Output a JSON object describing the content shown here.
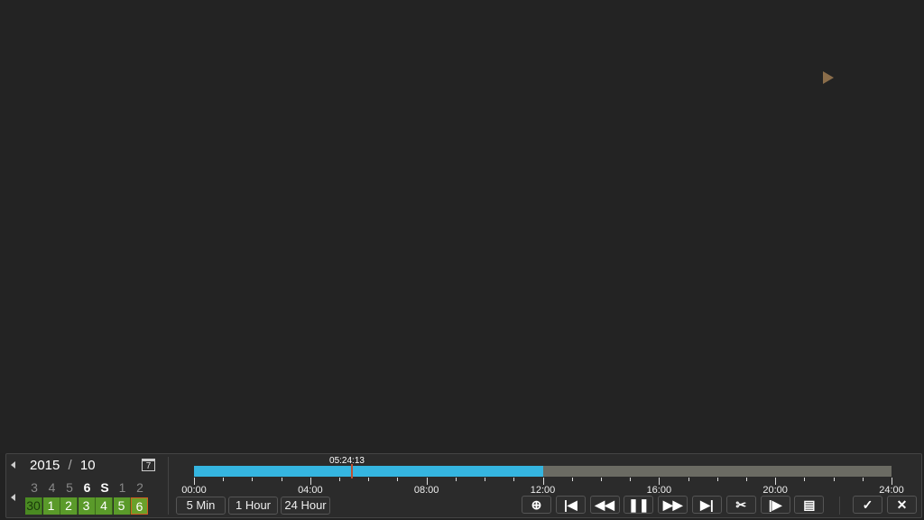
{
  "video": {
    "play_indicator_icon": "play-icon",
    "indicator_color": "#8a6d4a"
  },
  "calendar": {
    "year": "2015",
    "separator": "/",
    "month": "10",
    "calendar_icon_label": "7",
    "weekdays": [
      "3",
      "4",
      "5",
      "6",
      "S",
      "1",
      "2"
    ],
    "days": [
      "30",
      "1",
      "2",
      "3",
      "4",
      "5",
      "6"
    ],
    "selected_day": "6",
    "record_color": "#5a9a2a"
  },
  "timeline": {
    "current_time": "05:24:13",
    "current_hours": 5.4036,
    "recorded_ranges": [
      [
        0,
        12
      ]
    ],
    "record_color": "#35b5e0",
    "hour_labels": [
      "00:00",
      "04:00",
      "08:00",
      "12:00",
      "16:00",
      "20:00",
      "24:00"
    ]
  },
  "zoom_buttons": [
    "5 Min",
    "1 Hour",
    "24 Hour"
  ],
  "controls": [
    {
      "name": "zoom-in",
      "glyph": "⊕"
    },
    {
      "name": "previous",
      "glyph": "|◀"
    },
    {
      "name": "rewind",
      "glyph": "◀◀"
    },
    {
      "name": "pause",
      "glyph": "❚❚"
    },
    {
      "name": "fast-forward",
      "glyph": "▶▶"
    },
    {
      "name": "next",
      "glyph": "▶|"
    },
    {
      "name": "clip",
      "glyph": "✂"
    },
    {
      "name": "step-forward",
      "glyph": "|▶"
    },
    {
      "name": "display",
      "glyph": "▤"
    }
  ],
  "right_controls": [
    {
      "name": "hide",
      "glyph": "✓"
    },
    {
      "name": "close",
      "glyph": "✕"
    }
  ]
}
